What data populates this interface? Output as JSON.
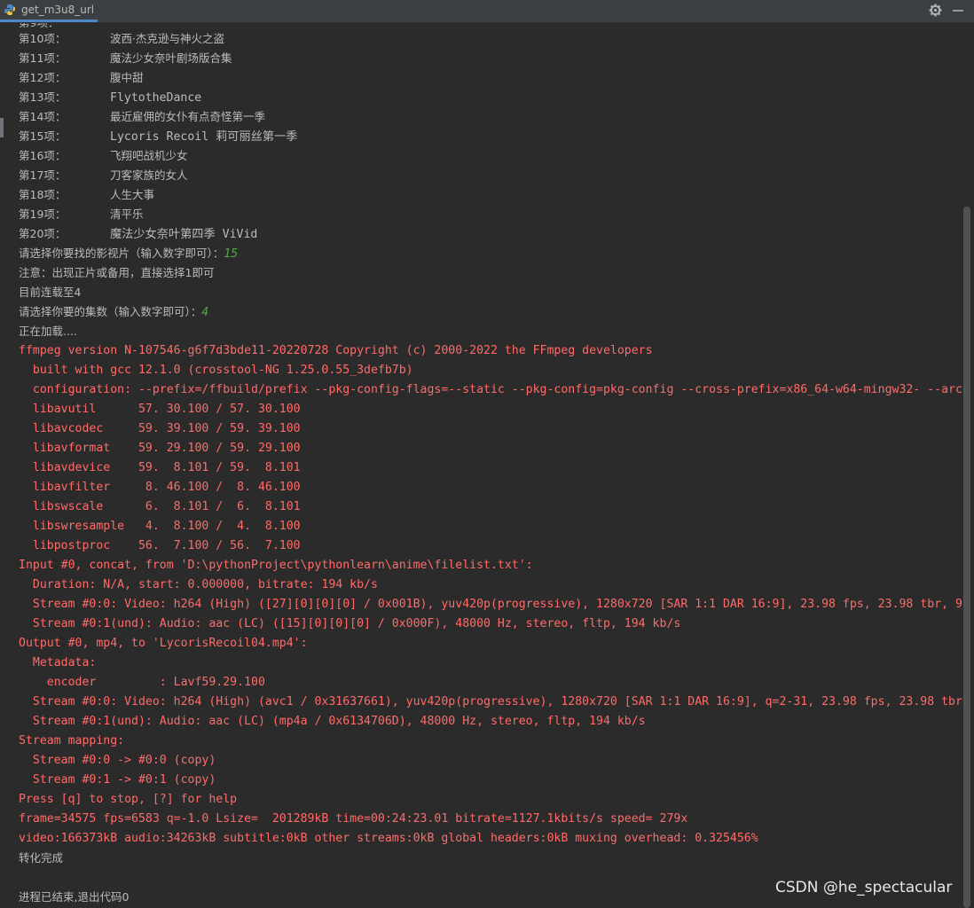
{
  "tab": {
    "title": "get_m3u8_url",
    "icon": "python-file-icon"
  },
  "toolbar": {
    "settings_icon": "gear-icon",
    "minimize_icon": "minimize-icon"
  },
  "colors": {
    "background": "#2b2b2b",
    "stdout": "#bbbbbb",
    "stderr": "#ff6b68",
    "user_input": "#52a846",
    "tab_underline": "#4a88c7"
  },
  "console": {
    "items": [
      {
        "label": "第10项：",
        "title": "波西·杰克逊与神火之盗"
      },
      {
        "label": "第11项：",
        "title": "魔法少女奈叶剧场版合集"
      },
      {
        "label": "第12项：",
        "title": "腹中甜"
      },
      {
        "label": "第13项：",
        "title": "FlytotheDance"
      },
      {
        "label": "第14项：",
        "title": "最近雇佣的女仆有点奇怪第一季"
      },
      {
        "label": "第15项：",
        "title": "Lycoris Recoil 莉可丽丝第一季"
      },
      {
        "label": "第16项：",
        "title": "飞翔吧战机少女"
      },
      {
        "label": "第17项：",
        "title": "刀客家族的女人"
      },
      {
        "label": "第18项：",
        "title": "人生大事"
      },
      {
        "label": "第19项：",
        "title": "清平乐"
      },
      {
        "label": "第20项：",
        "title": "魔法少女奈叶第四季 ViVid"
      }
    ],
    "prompt_select": "请选择你要找的影视片（输入数字即可）：",
    "input_select": "15",
    "note": "注意：出现正片或备用，直接选择1即可",
    "updated": "目前连载至4",
    "prompt_episode": "请选择你要的集数（输入数字即可）：",
    "input_episode": "4",
    "loading": "正在加载....",
    "ffmpeg_lines": [
      "ffmpeg version N-107546-g6f7d3bde11-20220728 Copyright (c) 2000-2022 the FFmpeg developers",
      "  built with gcc 12.1.0 (crosstool-NG 1.25.0.55_3defb7b)",
      "  configuration: --prefix=/ffbuild/prefix --pkg-config-flags=--static --pkg-config=pkg-config --cross-prefix=x86_64-w64-mingw32- --arc",
      "  libavutil      57. 30.100 / 57. 30.100",
      "  libavcodec     59. 39.100 / 59. 39.100",
      "  libavformat    59. 29.100 / 59. 29.100",
      "  libavdevice    59.  8.101 / 59.  8.101",
      "  libavfilter     8. 46.100 /  8. 46.100",
      "  libswscale      6.  8.101 /  6.  8.101",
      "  libswresample   4.  8.100 /  4.  8.100",
      "  libpostproc    56.  7.100 / 56.  7.100",
      "Input #0, concat, from 'D:\\pythonProject\\pythonlearn\\anime\\filelist.txt':",
      "  Duration: N/A, start: 0.000000, bitrate: 194 kb/s",
      "  Stream #0:0: Video: h264 (High) ([27][0][0][0] / 0x001B), yuv420p(progressive), 1280x720 [SAR 1:1 DAR 16:9], 23.98 fps, 23.98 tbr, 9",
      "  Stream #0:1(und): Audio: aac (LC) ([15][0][0][0] / 0x000F), 48000 Hz, stereo, fltp, 194 kb/s",
      "Output #0, mp4, to 'LycorisRecoil04.mp4':",
      "  Metadata:",
      "    encoder         : Lavf59.29.100",
      "  Stream #0:0: Video: h264 (High) (avc1 / 0x31637661), yuv420p(progressive), 1280x720 [SAR 1:1 DAR 16:9], q=2-31, 23.98 fps, 23.98 tbr",
      "  Stream #0:1(und): Audio: aac (LC) (mp4a / 0x6134706D), 48000 Hz, stereo, fltp, 194 kb/s",
      "Stream mapping:",
      "  Stream #0:0 -> #0:0 (copy)",
      "  Stream #0:1 -> #0:1 (copy)",
      "Press [q] to stop, [?] for help",
      "frame=34575 fps=6583 q=-1.0 Lsize=  201289kB time=00:24:23.01 bitrate=1127.1kbits/s speed= 279x",
      "video:166373kB audio:34263kB subtitle:0kB other streams:0kB global headers:0kB muxing overhead: 0.325456%"
    ],
    "done": "转化完成",
    "exit": "进程已结束,退出代码0"
  },
  "watermark": "CSDN @he_spectacular"
}
